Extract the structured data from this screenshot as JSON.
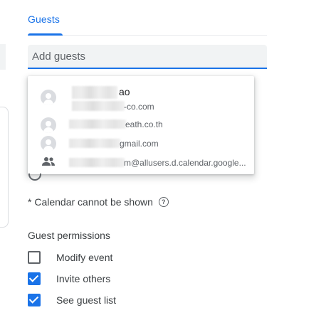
{
  "tab": {
    "label": "Guests"
  },
  "guest_input": {
    "value": "",
    "placeholder": "Add guests"
  },
  "suggestions": [
    {
      "name_suffix": "ao",
      "email_suffix": "-co.com"
    },
    {
      "name_suffix": "",
      "email_suffix": "eath.co.th"
    },
    {
      "name_suffix": "",
      "email_suffix": "gmail.com"
    },
    {
      "name_suffix": "",
      "email_suffix": "m@allusers.d.calendar.google..."
    }
  ],
  "calendar_note": {
    "text": "* Calendar cannot be shown",
    "help_glyph": "?"
  },
  "permissions": {
    "title": "Guest permissions",
    "items": [
      {
        "label": "Modify event",
        "checked": false
      },
      {
        "label": "Invite others",
        "checked": true
      },
      {
        "label": "See guest list",
        "checked": true
      }
    ]
  },
  "colors": {
    "accent": "#1a73e8",
    "text": "#3c4043",
    "muted": "#5f6368"
  }
}
